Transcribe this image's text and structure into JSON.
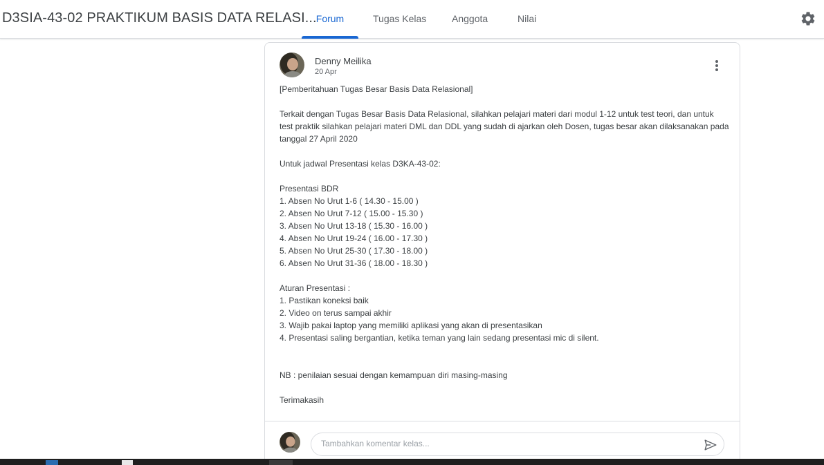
{
  "header": {
    "course_title": "D3SIA-43-02 PRAKTIKUM BASIS DATA RELASI...",
    "tabs": [
      {
        "label": "Forum",
        "active": true
      },
      {
        "label": "Tugas Kelas",
        "active": false
      },
      {
        "label": "Anggota",
        "active": false
      },
      {
        "label": "Nilai",
        "active": false
      }
    ],
    "settings_icon": "gear-icon"
  },
  "post": {
    "author": "Denny Meilika",
    "date": "20 Apr",
    "menu_icon": "more-vert-icon",
    "body": "[Pemberitahuan Tugas Besar Basis Data Relasional]\n\nTerkait dengan Tugas Besar Basis Data Relasional, silahkan pelajari materi dari modul 1-12 untuk test teori, dan untuk test praktik silahkan pelajari materi DML dan DDL yang sudah di ajarkan oleh Dosen, tugas besar akan dilaksanakan pada tanggal 27 April 2020\n\nUntuk jadwal Presentasi kelas D3KA-43-02:\n\nPresentasi BDR\n1. Absen No Urut 1-6 ( 14.30 - 15.00 )\n2. Absen No Urut 7-12 ( 15.00 - 15.30 )\n3. Absen No Urut 13-18 ( 15.30 - 16.00 )\n4. Absen No Urut 19-24 ( 16.00 - 17.30 )\n5. Absen No Urut 25-30 ( 17.30 - 18.00 )\n6. Absen No Urut 31-36 ( 18.00 - 18.30 )\n\nAturan Presentasi :\n1. Pastikan koneksi baik\n2. Video on terus sampai akhir\n3. Wajib pakai laptop yang memiliki aplikasi yang akan di presentasikan\n4. Presentasi saling bergantian, ketika teman yang lain sedang presentasi mic di silent.\n\n\nNB : penilaian sesuai dengan kemampuan diri masing-masing\n\nTerimakasih"
  },
  "comment": {
    "value": "",
    "placeholder": "Tambahkan komentar kelas...",
    "send_icon": "send-icon"
  },
  "colors": {
    "accent": "#1967d2",
    "border": "#dadce0",
    "text": "#3c4043",
    "muted": "#5f6368"
  }
}
